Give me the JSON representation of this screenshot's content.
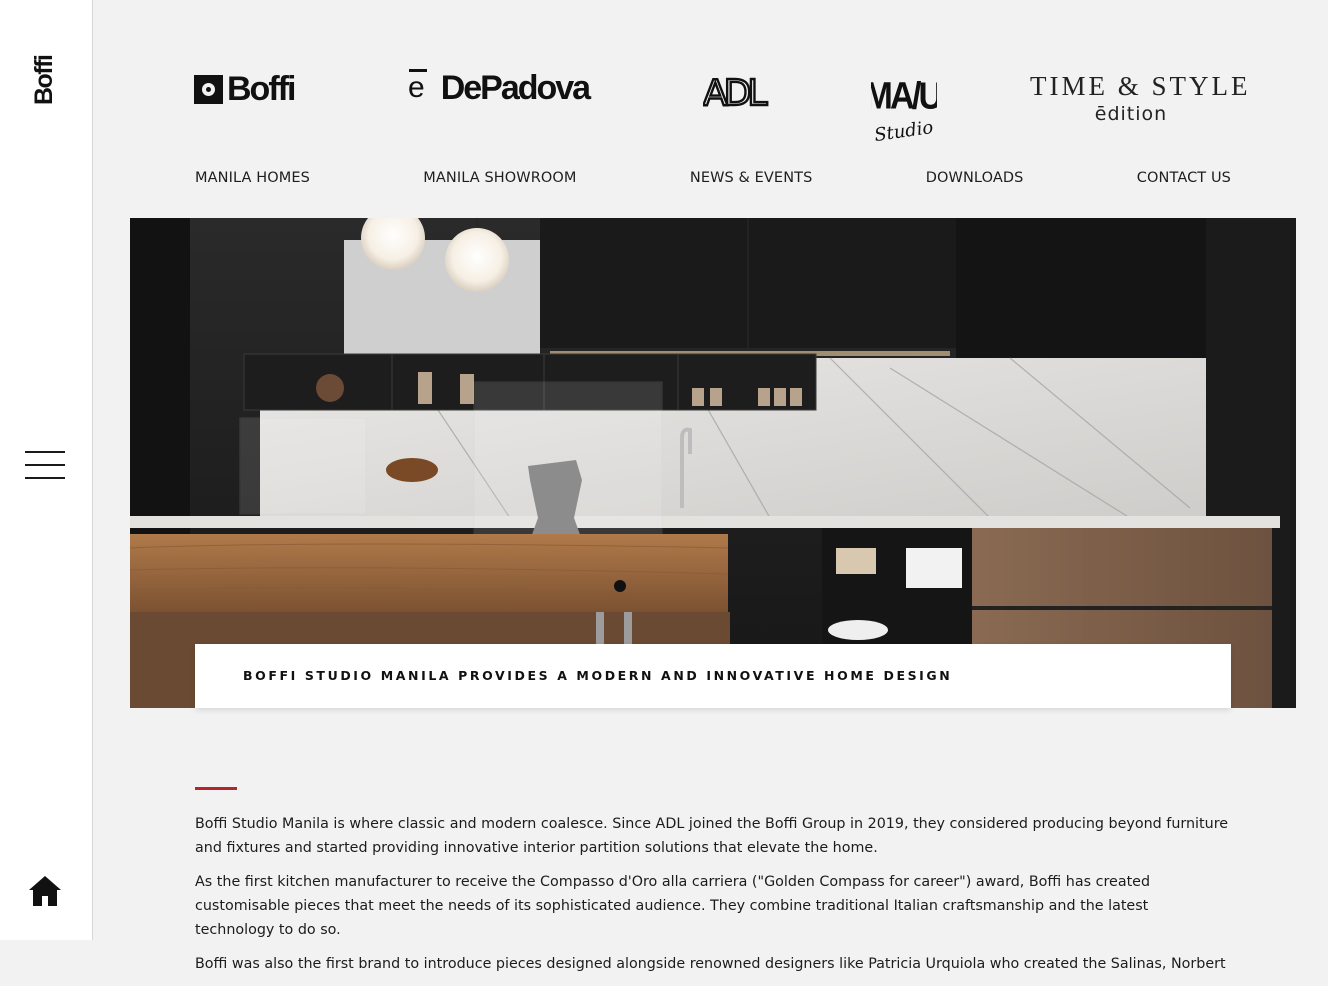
{
  "rail": {
    "logo_text": "Boffi",
    "menu_icon": "hamburger-menu-icon",
    "home_icon": "home-icon"
  },
  "brands": {
    "boffi": "Boffi",
    "depadova_mark": "e",
    "depadova": "DePadova",
    "adl": "ADL",
    "mau": "MA/U",
    "mau_script": "Studio",
    "timestyle_line1": "TIME & STYLE",
    "timestyle_line2": "ēdition"
  },
  "nav": {
    "items": [
      "MANILA HOMES",
      "MANILA SHOWROOM",
      "NEWS & EVENTS",
      "DOWNLOADS",
      "CONTACT US"
    ]
  },
  "hero": {
    "image": "kitchen-showroom-photo",
    "caption": "BOFFI STUDIO MANILA PROVIDES A MODERN AND INNOVATIVE HOME DESIGN"
  },
  "body": {
    "paragraphs": [
      "Boffi Studio Manila is where classic and modern coalesce. Since ADL joined the Boffi Group in 2019, they considered producing beyond furniture and fixtures and started providing innovative interior partition solutions that elevate the home.",
      "As the first kitchen manufacturer to receive the Compasso d'Oro alla carriera (\"Golden Compass for career\") award, Boffi has created customisable pieces that meet the needs of its sophisticated audience. They combine traditional Italian craftsmanship and the latest technology to do so.",
      "Boffi was also the first brand to introduce pieces designed alongside renowned designers like Patricia Urquiola who created the Salinas, Norbert"
    ]
  },
  "colors": {
    "background": "#f3f2f2",
    "accent_rule": "#b3262e",
    "text": "#1c1c1c"
  }
}
